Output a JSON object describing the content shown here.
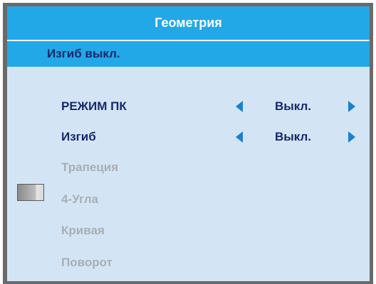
{
  "menu": {
    "title": "Геометрия",
    "status": "Изгиб выкл.",
    "items": [
      {
        "label": "РЕЖИМ ПК",
        "value": "Выкл.",
        "enabled": true
      },
      {
        "label": "Изгиб",
        "value": "Выкл.",
        "enabled": true
      },
      {
        "label": "Трапеция",
        "enabled": false
      },
      {
        "label": "4-Угла",
        "enabled": false
      },
      {
        "label": "Кривая",
        "enabled": false
      },
      {
        "label": "Поворот",
        "enabled": false
      }
    ]
  },
  "colors": {
    "title_bar": "#22a8e6",
    "panel_background": "#d3e5f5",
    "active_text": "#15286c",
    "disabled_text": "#a9aeb4",
    "arrow": "#1a7fd0",
    "frame": "#6a6a6a"
  }
}
